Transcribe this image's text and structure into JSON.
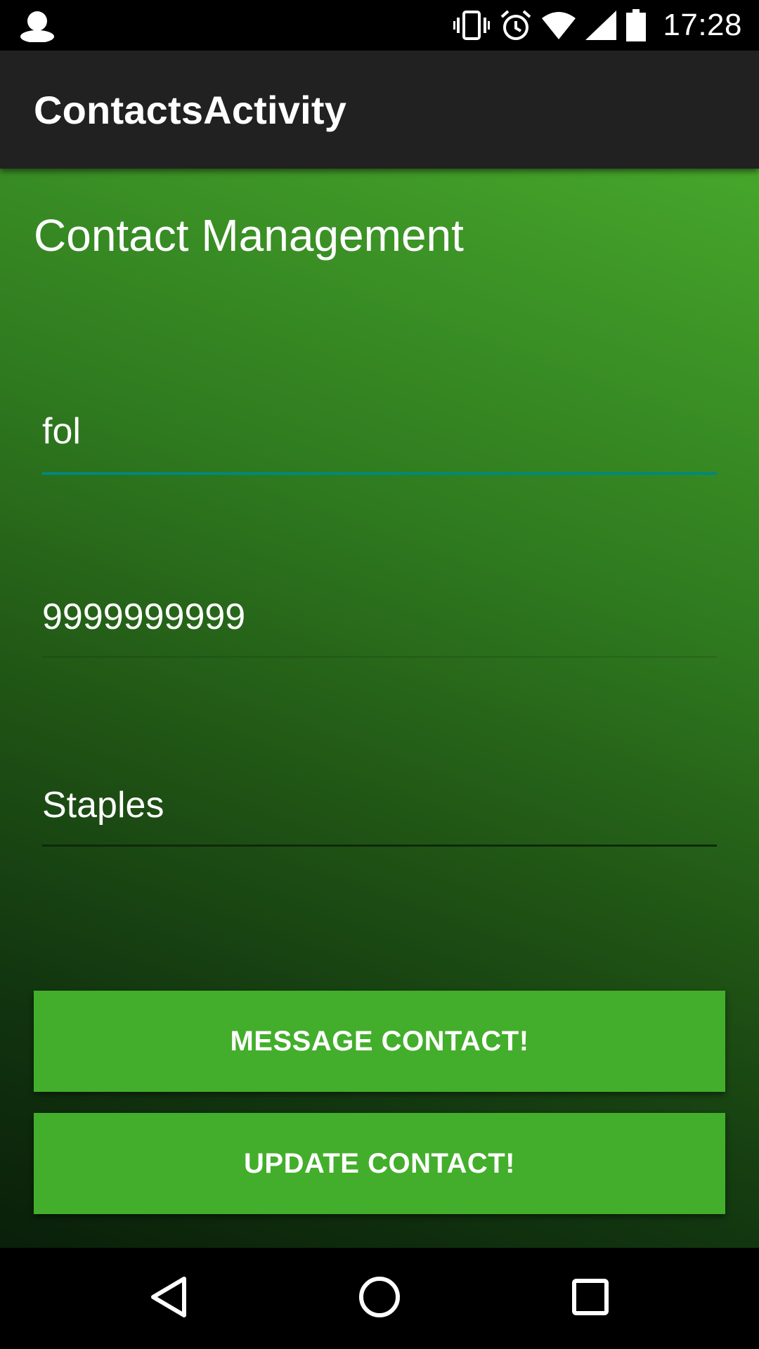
{
  "status_bar": {
    "time": "17:28",
    "icons": [
      "account-icon",
      "vibrate-icon",
      "alarm-icon",
      "wifi-icon",
      "signal-icon",
      "battery-icon"
    ]
  },
  "app_bar": {
    "title": "ContactsActivity"
  },
  "main": {
    "heading": "Contact Management",
    "fields": {
      "name": "fol",
      "phone": "9999999999",
      "company": "Staples"
    },
    "buttons": {
      "message": "MESSAGE CONTACT!",
      "update": "UPDATE CONTACT!"
    }
  },
  "nav_bar": {
    "icons": [
      "back-icon",
      "home-icon",
      "recents-icon"
    ]
  },
  "colors": {
    "app_bar": "#212121",
    "button": "#43ae2b",
    "focused_underline": "#00897b",
    "status_bar": "#000000"
  }
}
